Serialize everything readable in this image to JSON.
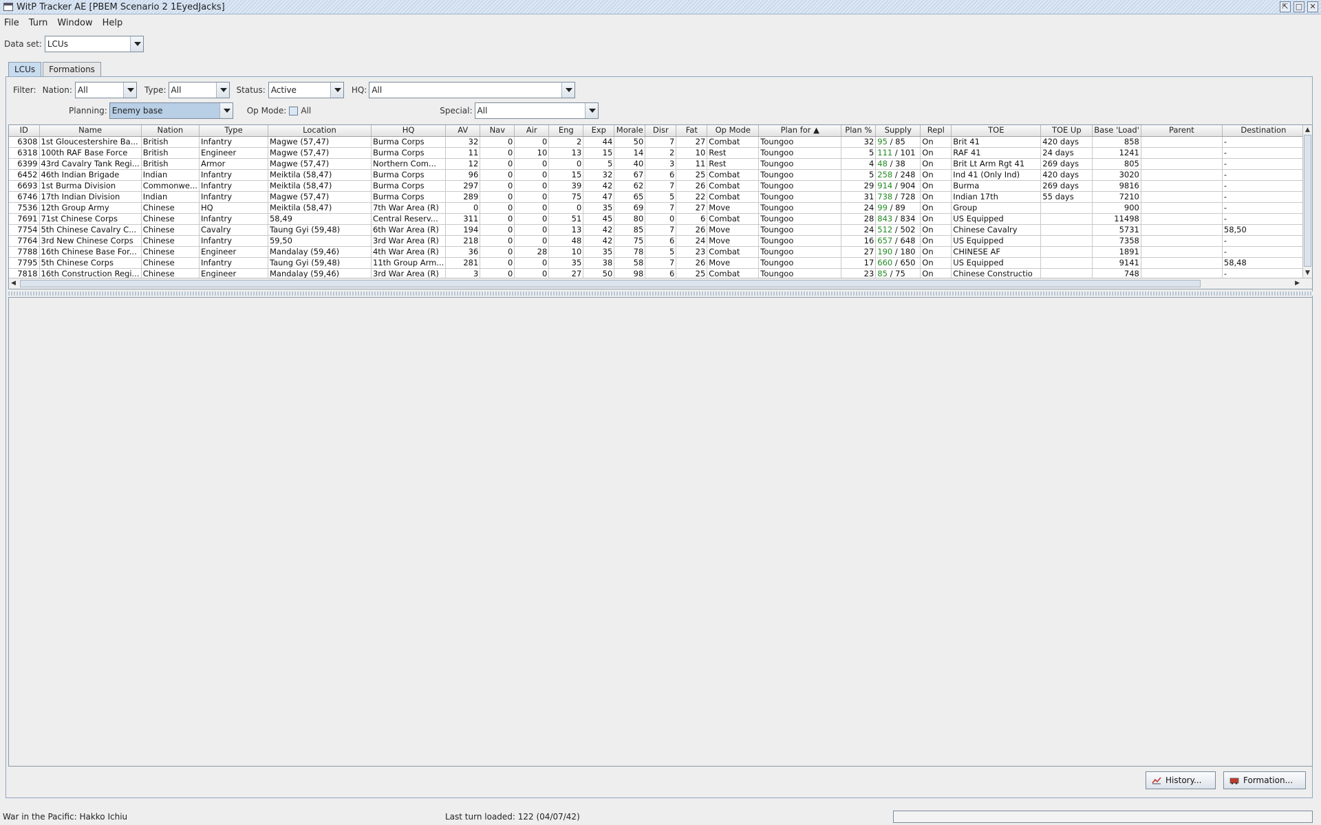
{
  "window": {
    "title": "WitP Tracker AE [PBEM Scenario 2 1EyedJacks]",
    "buttons": {
      "iconify": "⇱",
      "maximize": "□",
      "close": "✕"
    }
  },
  "menu": [
    "File",
    "Turn",
    "Window",
    "Help"
  ],
  "dataset": {
    "label": "Data set:",
    "value": "LCUs"
  },
  "tabs": [
    "LCUs",
    "Formations"
  ],
  "filters": {
    "filter_label": "Filter:",
    "nation": {
      "label": "Nation:",
      "value": "All"
    },
    "type": {
      "label": "Type:",
      "value": "All"
    },
    "status": {
      "label": "Status:",
      "value": "Active"
    },
    "hq": {
      "label": "HQ:",
      "value": "All"
    },
    "planning": {
      "label": "Planning:",
      "value": "Enemy base"
    },
    "opmode": {
      "label": "Op Mode:",
      "value": "All"
    },
    "special": {
      "label": "Special:",
      "value": "All"
    }
  },
  "table": {
    "columns": [
      "ID",
      "Name",
      "Nation",
      "Type",
      "Location",
      "HQ",
      "AV",
      "Nav",
      "Air",
      "Eng",
      "Exp",
      "Morale",
      "Disr",
      "Fat",
      "Op Mode",
      "Plan for ▲",
      "Plan %",
      "Supply",
      "Repl",
      "TOE",
      "TOE Up",
      "Base 'Load'",
      "Parent",
      "Destination"
    ],
    "rows": [
      [
        "6308",
        "1st Gloucestershire Ba...",
        "British",
        "Infantry",
        "Magwe (57,47)",
        "Burma Corps",
        "32",
        "0",
        "0",
        "2",
        "44",
        "50",
        "7",
        "27",
        "Combat",
        "Toungoo",
        "32",
        "95",
        "85",
        "On",
        "Brit 41",
        "420 days",
        "858",
        "",
        "-"
      ],
      [
        "6318",
        "100th RAF Base Force",
        "British",
        "Engineer",
        "Magwe (57,47)",
        "Burma Corps",
        "11",
        "0",
        "10",
        "13",
        "15",
        "14",
        "2",
        "10",
        "Rest",
        "Toungoo",
        "5",
        "111",
        "101",
        "On",
        "RAF 41",
        "24 days",
        "1241",
        "",
        "-"
      ],
      [
        "6399",
        "43rd Cavalry Tank Regi...",
        "British",
        "Armor",
        "Magwe (57,47)",
        "Northern Com...",
        "12",
        "0",
        "0",
        "0",
        "5",
        "40",
        "3",
        "11",
        "Rest",
        "Toungoo",
        "4",
        "48",
        "38",
        "On",
        "Brit Lt Arm Rgt 41",
        "269 days",
        "805",
        "",
        "-"
      ],
      [
        "6452",
        "46th Indian Brigade",
        "Indian",
        "Infantry",
        "Meiktila (58,47)",
        "Burma Corps",
        "96",
        "0",
        "0",
        "15",
        "32",
        "67",
        "6",
        "25",
        "Combat",
        "Toungoo",
        "5",
        "258",
        "248",
        "On",
        "Ind 41 (Only Ind)",
        "420 days",
        "3020",
        "",
        "-"
      ],
      [
        "6693",
        "1st Burma Division",
        "Commonwe...",
        "Infantry",
        "Meiktila (58,47)",
        "Burma Corps",
        "297",
        "0",
        "0",
        "39",
        "42",
        "62",
        "7",
        "26",
        "Combat",
        "Toungoo",
        "29",
        "914",
        "904",
        "On",
        "Burma",
        "269 days",
        "9816",
        "",
        "-"
      ],
      [
        "6746",
        "17th Indian Division",
        "Indian",
        "Infantry",
        "Magwe (57,47)",
        "Burma Corps",
        "289",
        "0",
        "0",
        "75",
        "47",
        "65",
        "5",
        "22",
        "Combat",
        "Toungoo",
        "31",
        "738",
        "728",
        "On",
        "Indian 17th",
        "55 days",
        "7210",
        "",
        "-"
      ],
      [
        "7536",
        "12th Group Army",
        "Chinese",
        "HQ",
        "Meiktila (58,47)",
        "7th War Area (R)",
        "0",
        "0",
        "0",
        "0",
        "35",
        "69",
        "7",
        "27",
        "Move",
        "Toungoo",
        "24",
        "99",
        "89",
        "On",
        "Group",
        "",
        "900",
        "",
        "-"
      ],
      [
        "7691",
        "71st Chinese Corps",
        "Chinese",
        "Infantry",
        "58,49",
        "Central Reserv...",
        "311",
        "0",
        "0",
        "51",
        "45",
        "80",
        "0",
        "6",
        "Combat",
        "Toungoo",
        "28",
        "843",
        "834",
        "On",
        "US Equipped",
        "",
        "11498",
        "",
        "-"
      ],
      [
        "7754",
        "5th Chinese Cavalry C...",
        "Chinese",
        "Cavalry",
        "Taung Gyi (59,48)",
        "6th War Area (R)",
        "194",
        "0",
        "0",
        "13",
        "42",
        "85",
        "7",
        "26",
        "Move",
        "Toungoo",
        "24",
        "512",
        "502",
        "On",
        "Chinese Cavalry",
        "",
        "5731",
        "",
        "58,50"
      ],
      [
        "7764",
        "3rd New Chinese Corps",
        "Chinese",
        "Infantry",
        "59,50",
        "3rd War Area (R)",
        "218",
        "0",
        "0",
        "48",
        "42",
        "75",
        "6",
        "24",
        "Move",
        "Toungoo",
        "16",
        "657",
        "648",
        "On",
        "US Equipped",
        "",
        "7358",
        "",
        "-"
      ],
      [
        "7788",
        "16th Chinese Base For...",
        "Chinese",
        "Engineer",
        "Mandalay (59,46)",
        "4th War Area (R)",
        "36",
        "0",
        "28",
        "10",
        "35",
        "78",
        "5",
        "23",
        "Combat",
        "Toungoo",
        "27",
        "190",
        "180",
        "On",
        "CHINESE AF",
        "",
        "1891",
        "",
        "-"
      ],
      [
        "7795",
        "5th Chinese Corps",
        "Chinese",
        "Infantry",
        "Taung Gyi (59,48)",
        "11th Group Arm...",
        "281",
        "0",
        "0",
        "35",
        "38",
        "58",
        "7",
        "26",
        "Move",
        "Toungoo",
        "17",
        "660",
        "650",
        "On",
        "US Equipped",
        "",
        "9141",
        "",
        "58,48"
      ],
      [
        "7818",
        "16th Construction Regi...",
        "Chinese",
        "Engineer",
        "Mandalay (59,46)",
        "3rd War Area (R)",
        "3",
        "0",
        "0",
        "27",
        "50",
        "98",
        "6",
        "25",
        "Combat",
        "Toungoo",
        "23",
        "85",
        "75",
        "On",
        "Chinese Constructio",
        "",
        "748",
        "",
        "-"
      ]
    ]
  },
  "buttons": {
    "history": "History...",
    "formation": "Formation..."
  },
  "status": {
    "left": "War in the Pacific: Hakko Ichiu",
    "center": "Last turn loaded: 122 (04/07/42)"
  }
}
